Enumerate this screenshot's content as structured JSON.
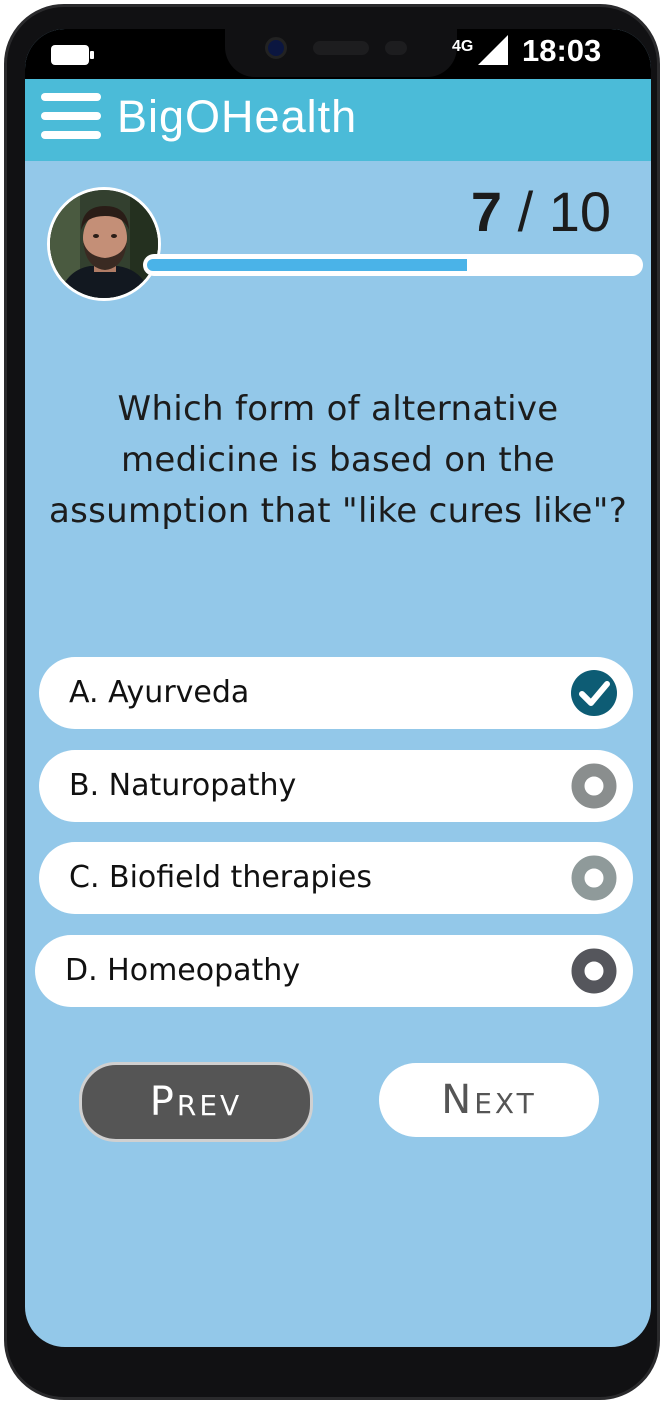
{
  "status_bar": {
    "network": "4G",
    "time": "18:03"
  },
  "app": {
    "title": "BigOHealth"
  },
  "progress": {
    "current": "7",
    "separator": "/",
    "total": "10",
    "fraction": 0.65
  },
  "question": {
    "text": "Which form of alternative medicine is based on the assumption that \"like cures like\"?"
  },
  "options": [
    {
      "label": "A. Ayurveda",
      "state": "checked",
      "color": "#0d5c74"
    },
    {
      "label": "B. Naturopathy",
      "state": "unselected",
      "color": "#8a8e8e"
    },
    {
      "label": "C. Biofield therapies",
      "state": "unselected",
      "color": "#8f9a9a"
    },
    {
      "label": "D. Homeopathy",
      "state": "unselected",
      "color": "#55565c"
    }
  ],
  "nav": {
    "prev_label": "Prev",
    "next_label": "Next"
  },
  "colors": {
    "app_bar": "#4bbbd8",
    "background": "#93c8e9",
    "progress_fill": "#4ab3e8"
  }
}
